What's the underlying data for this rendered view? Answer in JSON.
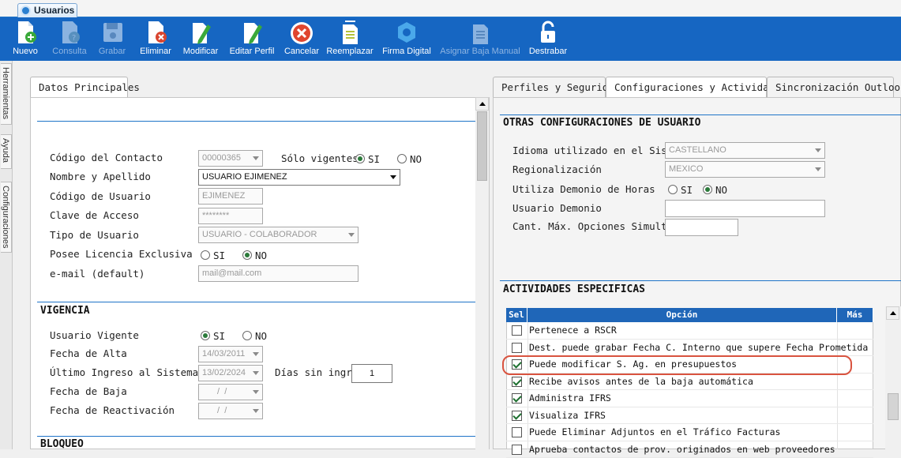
{
  "window": {
    "tab_title": "Usuarios"
  },
  "toolbar": [
    {
      "label": "Nuevo",
      "icon": "new-doc-icon",
      "enabled": true
    },
    {
      "label": "Consulta",
      "icon": "query-icon",
      "enabled": false
    },
    {
      "label": "Grabar",
      "icon": "save-icon",
      "enabled": false
    },
    {
      "label": "Eliminar",
      "icon": "delete-icon",
      "enabled": true
    },
    {
      "label": "Modificar",
      "icon": "edit-icon",
      "enabled": true
    },
    {
      "label": "Editar Perfil",
      "icon": "edit-profile-icon",
      "enabled": true
    },
    {
      "label": "Cancelar",
      "icon": "cancel-icon",
      "enabled": true
    },
    {
      "label": "Reemplazar",
      "icon": "replace-icon",
      "enabled": true
    },
    {
      "label": "Firma Digital",
      "icon": "digital-signature-icon",
      "enabled": true
    },
    {
      "label": "Asignar Baja Manual",
      "icon": "manual-drop-icon",
      "enabled": false
    },
    {
      "label": "Destrabar",
      "icon": "unlock-icon",
      "enabled": true
    }
  ],
  "side_tabs": [
    "Herramientas",
    "Ayuda",
    "Configuraciones"
  ],
  "left_panel": {
    "tab": "Datos Principales",
    "fields": {
      "codigo_contacto_label": "Código del Contacto",
      "codigo_contacto": "00000365",
      "solo_vigentes_label": "Sólo vigentes",
      "si": "SI",
      "no": "NO",
      "nombre_label": "Nombre y Apellido",
      "nombre": "USUARIO EJIMENEZ",
      "codigo_usuario_label": "Código de Usuario",
      "codigo_usuario": "EJIMENEZ",
      "clave_label": "Clave de Acceso",
      "clave": "********",
      "tipo_label": "Tipo de Usuario",
      "tipo": "USUARIO - COLABORADOR",
      "licencia_label": "Posee Licencia Exclusiva",
      "email_label": "e-mail (default)",
      "email_placeholder": "mail@mail.com"
    },
    "vigencia": {
      "title": "VIGENCIA",
      "vigente_label": "Usuario Vigente",
      "alta_label": "Fecha de Alta",
      "alta": "14/03/2011",
      "ultimo_label": "Último Ingreso al Sistema",
      "ultimo": "13/02/2024",
      "dias_label": "Días sin ingreso",
      "dias": "1",
      "baja_label": "Fecha de Baja",
      "baja": " /  /",
      "reactivacion_label": "Fecha de Reactivación",
      "reactivacion": " /  /"
    },
    "bloqueo_title": "BLOQUEO"
  },
  "right_panel": {
    "tabs": [
      "Perfiles y Seguridad",
      "Configuraciones y Actividades",
      "Sincronización Outlook"
    ],
    "otras": {
      "title": "OTRAS CONFIGURACIONES DE USUARIO",
      "idioma_label": "Idioma utilizado en el Sistema",
      "idioma": "CASTELLANO",
      "regional_label": "Regionalización",
      "regional": "MEXICO",
      "demonio_label": "Utiliza Demonio de Horas",
      "usuario_demonio_label": "Usuario Demonio",
      "cant_label": "Cant. Máx. Opciones Simult.",
      "si": "SI",
      "no": "NO"
    },
    "actividades": {
      "title": "ACTIVIDADES ESPECIFICAS",
      "headers": {
        "sel": "Sel",
        "opcion": "Opción",
        "mas": "Más"
      },
      "rows": [
        {
          "checked": false,
          "text": "Pertenece a RSCR"
        },
        {
          "checked": false,
          "text": "Dest. puede grabar Fecha C. Interno que supere Fecha Prometida"
        },
        {
          "checked": true,
          "text": "Puede modificar S. Ag. en presupuestos"
        },
        {
          "checked": true,
          "text": "Recibe avisos antes de la baja automática"
        },
        {
          "checked": true,
          "text": "Administra IFRS"
        },
        {
          "checked": true,
          "text": "Visualiza IFRS"
        },
        {
          "checked": false,
          "text": "Puede Eliminar Adjuntos en el Tráfico Facturas"
        },
        {
          "checked": false,
          "text": "Aprueba contactos de prov. originados en web proveedores"
        }
      ]
    }
  },
  "colors": {
    "toolbar": "#1666c2",
    "grid_header": "#1f66b8",
    "highlight": "#d9533f"
  }
}
